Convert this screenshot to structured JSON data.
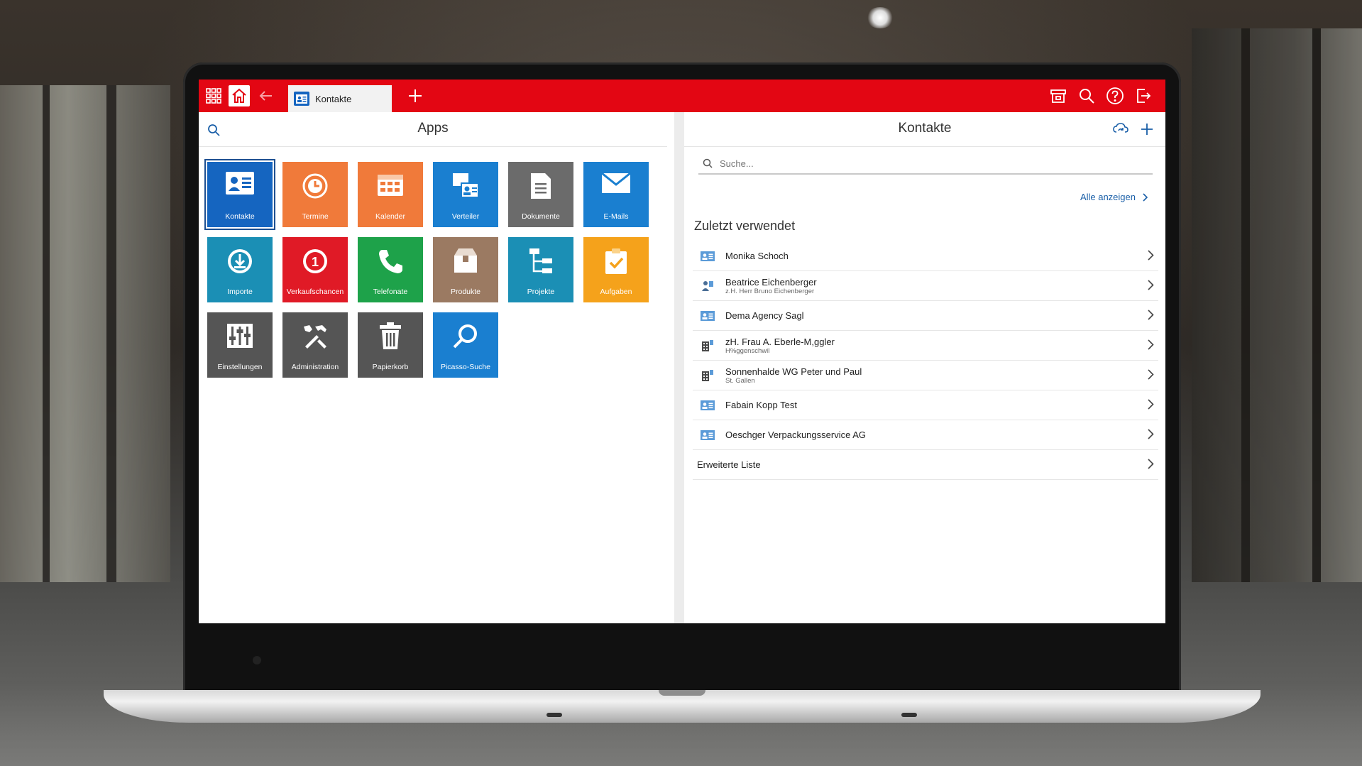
{
  "tab": {
    "label": "Kontakte"
  },
  "apps_panel": {
    "title": "Apps",
    "tiles": [
      {
        "label": "Kontakte",
        "icon": "contact-card-icon",
        "color": "#1565c0"
      },
      {
        "label": "Termine",
        "icon": "clock-icon",
        "color": "#f07a3a"
      },
      {
        "label": "Kalender",
        "icon": "calendar-icon",
        "color": "#f07a3a"
      },
      {
        "label": "Verteiler",
        "icon": "distribution-icon",
        "color": "#1a7fd0"
      },
      {
        "label": "Dokumente",
        "icon": "document-icon",
        "color": "#6b6b6b"
      },
      {
        "label": "E-Mails",
        "icon": "envelope-icon",
        "color": "#1a7fd0"
      },
      {
        "label": "Importe",
        "icon": "import-icon",
        "color": "#1b8fb5"
      },
      {
        "label": "Verkaufschancen",
        "icon": "opportunity-icon",
        "color": "#e01a26"
      },
      {
        "label": "Telefonate",
        "icon": "phone-icon",
        "color": "#1ea24a"
      },
      {
        "label": "Produkte",
        "icon": "box-icon",
        "color": "#9b7a62"
      },
      {
        "label": "Projekte",
        "icon": "project-tree-icon",
        "color": "#1b8fb5"
      },
      {
        "label": "Aufgaben",
        "icon": "clipboard-check-icon",
        "color": "#f5a21b"
      },
      {
        "label": "Einstellungen",
        "icon": "sliders-icon",
        "color": "#555555"
      },
      {
        "label": "Administration",
        "icon": "tools-icon",
        "color": "#555555"
      },
      {
        "label": "Papierkorb",
        "icon": "trash-icon",
        "color": "#555555"
      },
      {
        "label": "Picasso-Suche",
        "icon": "magnifier-icon",
        "color": "#1a7fd0"
      }
    ]
  },
  "contacts_panel": {
    "title": "Kontakte",
    "search_placeholder": "Suche...",
    "show_all_label": "Alle anzeigen",
    "recent_title": "Zuletzt verwendet",
    "recent_items": [
      {
        "title": "Monika Schoch",
        "subtitle": "",
        "icon": "contact-card-icon"
      },
      {
        "title": "Beatrice Eichenberger",
        "subtitle": "z.H. Herr Bruno Eichenberger",
        "icon": "contact-person-icon"
      },
      {
        "title": "Dema Agency Sagl",
        "subtitle": "",
        "icon": "contact-card-icon"
      },
      {
        "title": "zH. Frau A. Eberle-M,ggler",
        "subtitle": "H%ggenschwil",
        "icon": "building-icon"
      },
      {
        "title": "Sonnenhalde WG Peter und Paul",
        "subtitle": "St. Gallen",
        "icon": "building-icon"
      },
      {
        "title": "Fabain Kopp Test",
        "subtitle": "",
        "icon": "contact-card-icon"
      },
      {
        "title": "Oeschger Verpackungsservice AG",
        "subtitle": "",
        "icon": "contact-card-icon"
      }
    ],
    "extended_list_label": "Erweiterte Liste"
  },
  "colors": {
    "topbar": "#e30613",
    "link": "#1a5fa8"
  }
}
